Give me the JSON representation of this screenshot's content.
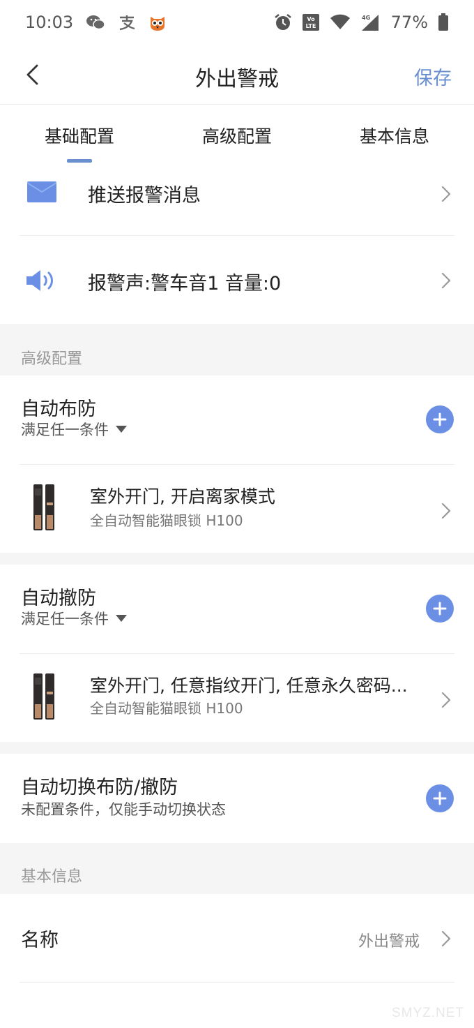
{
  "status_bar": {
    "time": "10:03",
    "battery": "77%",
    "network": "4G",
    "volte": "Vo LTE"
  },
  "header": {
    "title": "外出警戒",
    "save_label": "保存"
  },
  "tabs": [
    {
      "label": "基础配置",
      "active": true
    },
    {
      "label": "高级配置",
      "active": false
    },
    {
      "label": "基本信息",
      "active": false
    }
  ],
  "basic": {
    "push_label": "推送报警消息",
    "sound_label": "报警声:警车音1 音量:0"
  },
  "advanced": {
    "section_title": "高级配置",
    "arm": {
      "title": "自动布防",
      "condition_mode": "满足任一条件",
      "item_title": "室外开门, 开启离家模式",
      "item_device": "全自动智能猫眼锁 H100"
    },
    "disarm": {
      "title": "自动撤防",
      "condition_mode": "满足任一条件",
      "item_title": "室外开门, 任意指纹开门, 任意永久密码...",
      "item_device": "全自动智能猫眼锁 H100"
    },
    "switch": {
      "title": "自动切换布防/撤防",
      "subtitle": "未配置条件，仅能手动切换状态"
    }
  },
  "info": {
    "section_title": "基本信息",
    "name_label": "名称",
    "name_value": "外出警戒"
  },
  "watermark": "SMYZ.NET",
  "colors": {
    "accent": "#6a8fcf",
    "plus_button": "#6a8fe4",
    "gap_background": "#f5f5f5"
  },
  "icons": {
    "back": "chevron-left-icon",
    "push": "envelope-icon",
    "sound": "speaker-icon",
    "add": "plus-icon",
    "row_arrow": "chevron-right-icon",
    "dropdown": "triangle-down-icon"
  }
}
